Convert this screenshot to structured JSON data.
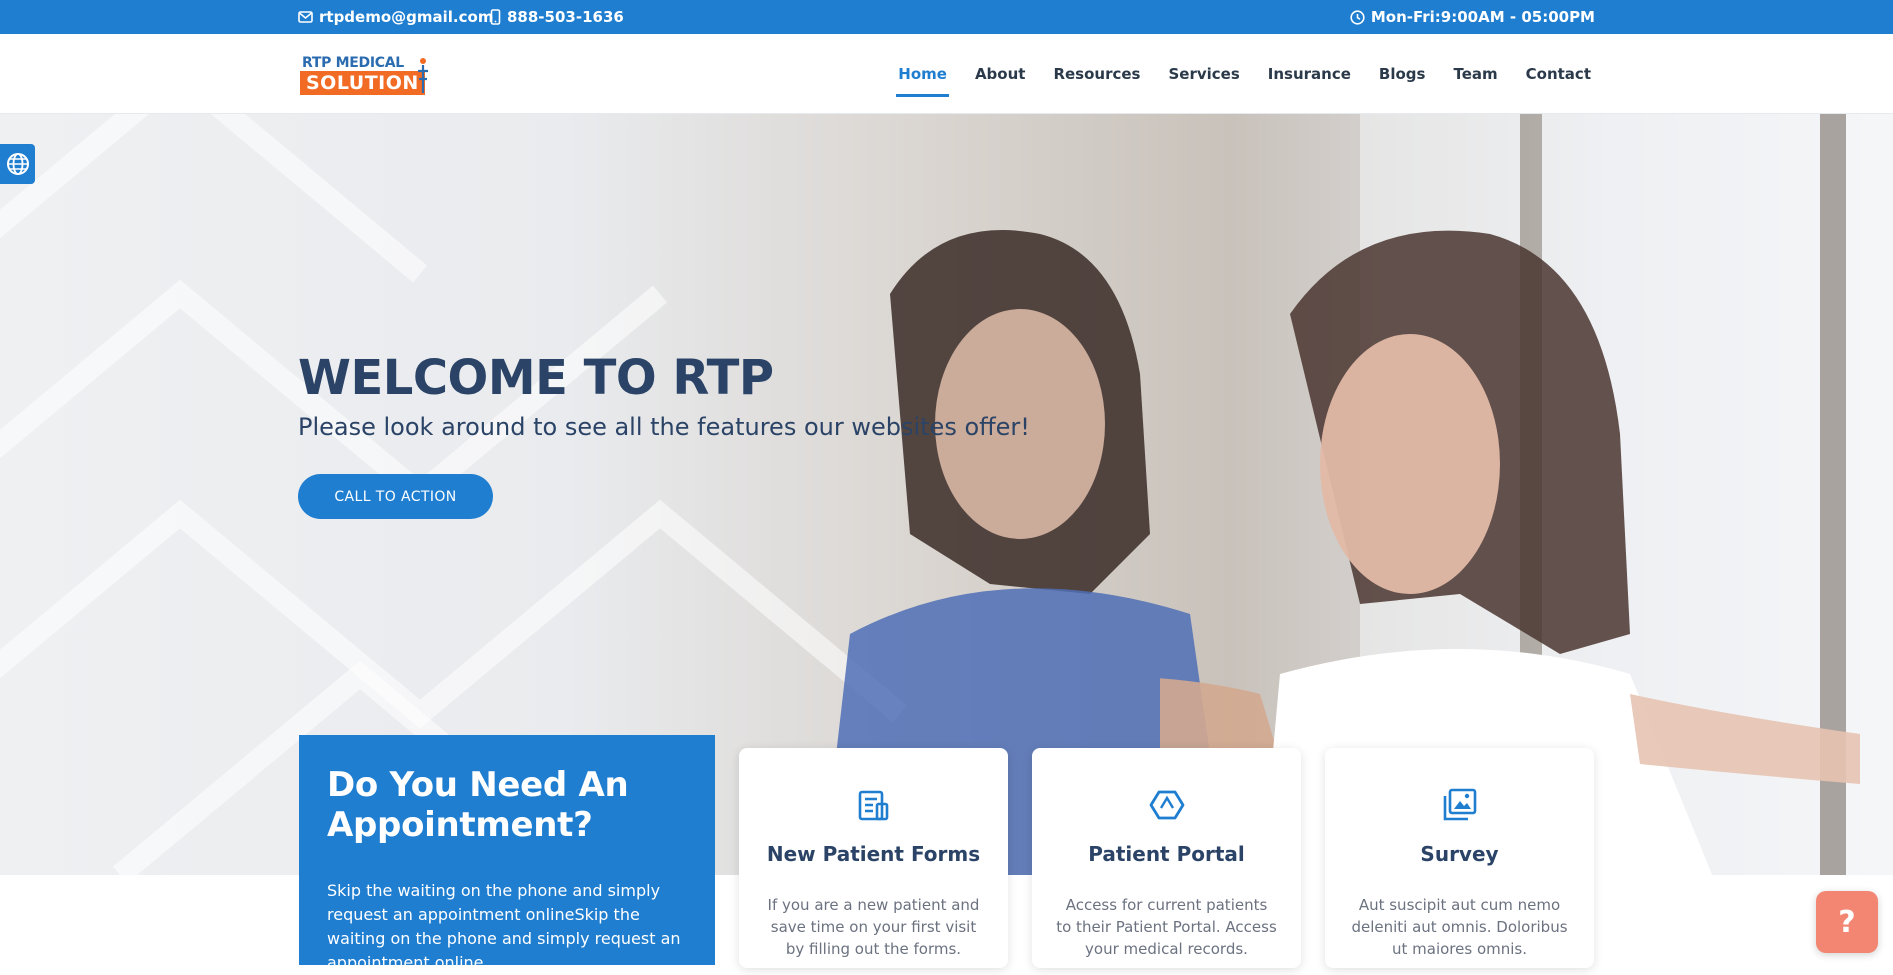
{
  "topbar": {
    "email": "rtpdemo@gmail.com",
    "phone": "888-503-1636",
    "hours": "Mon-Fri:9:00AM - 05:00PM",
    "email_icon": "envelope-icon",
    "phone_icon": "mobile-phone-icon",
    "hours_icon": "clock-icon"
  },
  "logo": {
    "line1": "RTP MEDICAL",
    "line2": "SOLUTION"
  },
  "nav": {
    "items": [
      {
        "label": "Home",
        "active": true
      },
      {
        "label": "About"
      },
      {
        "label": "Resources"
      },
      {
        "label": "Services"
      },
      {
        "label": "Insurance"
      },
      {
        "label": "Blogs"
      },
      {
        "label": "Team"
      },
      {
        "label": "Contact"
      }
    ]
  },
  "hero": {
    "title": "WELCOME TO RTP",
    "subtitle": "Please look around to see all the features our websites offer!",
    "cta_label": "CALL TO ACTION"
  },
  "appointment": {
    "title": "Do You Need An Appointment?",
    "text": "Skip the waiting on the phone and simply request an appointment onlineSkip the waiting on the phone and simply request an appointment online."
  },
  "cards": [
    {
      "title": "New Patient Forms",
      "text": "If you are a new patient and save time on your first visit by filling out the forms.",
      "icon": "form-document-icon"
    },
    {
      "title": "Patient Portal",
      "text": "Access for current patients to their Patient Portal. Access your medical records.",
      "icon": "hexagon-cube-icon"
    },
    {
      "title": "Survey",
      "text": "Aut suscipit aut cum nemo deleniti aut omnis. Doloribus ut maiores omnis.",
      "icon": "image-gallery-icon"
    }
  ],
  "help_button": "?",
  "colors": {
    "primary": "#1f7ed0",
    "heading": "#2a4366",
    "logo_orange": "#f26b24",
    "help": "#f28672"
  }
}
